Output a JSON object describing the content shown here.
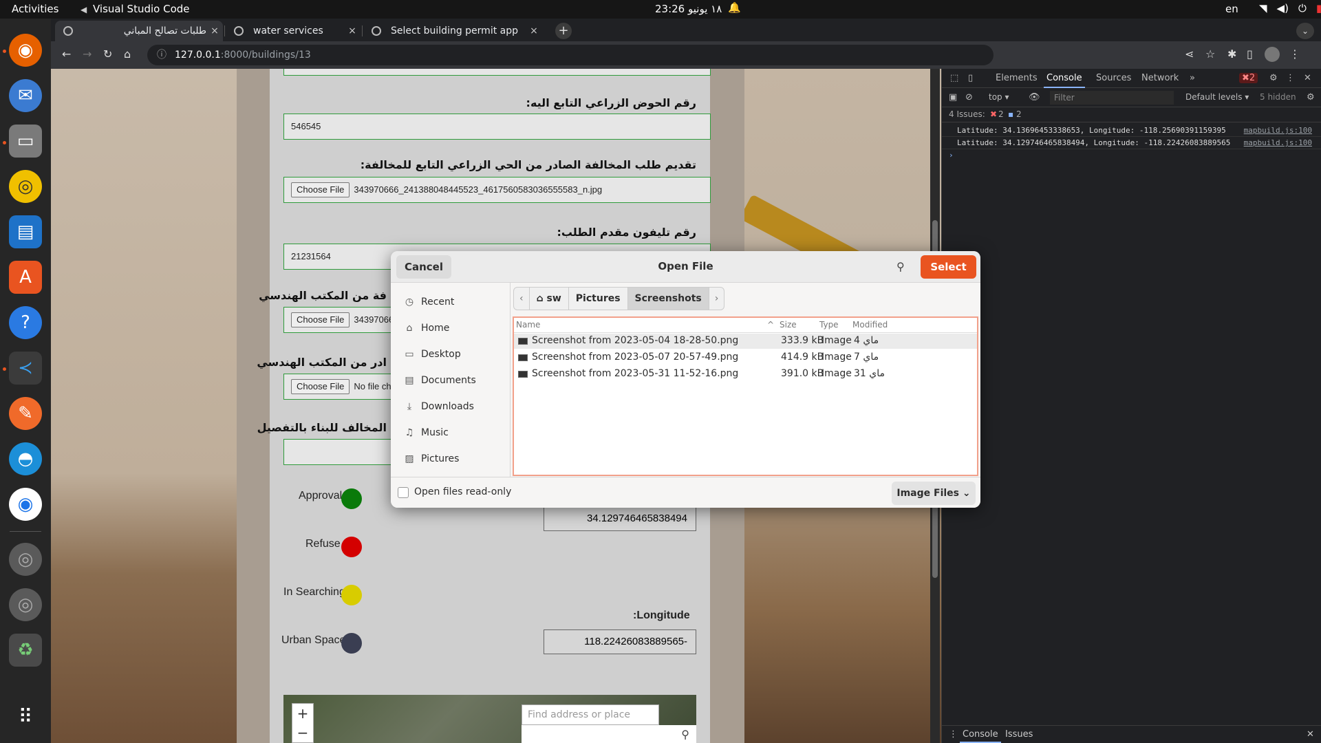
{
  "topbar": {
    "activities": "Activities",
    "app_name": "Visual Studio Code",
    "clock": "23:26 ١٨ يونيو",
    "lang": "en"
  },
  "browser": {
    "tabs": [
      {
        "title": "طلبات تصالح المباني",
        "close": "×"
      },
      {
        "title": "water services",
        "close": "×"
      },
      {
        "title": "Select building permit app",
        "close": "×"
      }
    ],
    "new_tab": "+",
    "url_host": "127.0.0.1",
    "url_path": ":8000/buildings/13"
  },
  "form": {
    "field1_label": "رقم الحوض الزراعي التابع اليه:",
    "field1_value": "546545",
    "field2_label": "تقديم طلب المخالفة الصادر من الحي الزراعي التابع للمخالفة:",
    "field2_button": "Choose File",
    "field2_file": "343970666_241388048445523_4617560583036555583_n.jpg",
    "field3_label": "رقم تليفون مقدم الطلب:",
    "field3_value": "21231564",
    "field4_label": "فة من المكتب الهندسي",
    "field4_button": "Choose File",
    "field4_file": "343970666",
    "field5_label": "ادر من المكتب الهندسي",
    "field5_button": "Choose File",
    "field5_file": "No file ch",
    "field6_label": "المخالف للبناء بالتفصيل",
    "legend": [
      {
        "label": "Approval",
        "color": "#0a7a0a"
      },
      {
        "label": "Refuse",
        "color": "#d40000"
      },
      {
        "label": "In Searching",
        "color": "#d8cc00"
      },
      {
        "label": "Urban Space",
        "color": "#3a3e52"
      }
    ],
    "latitude_value": "34.129746465838494",
    "longitude_label": ":Longitude",
    "longitude_value": "118.22426083889565-",
    "map_search_placeholder": "Find address or place",
    "map_zoom_in": "+",
    "map_zoom_out": "−"
  },
  "devtools": {
    "tabs": [
      "Elements",
      "Console",
      "Sources",
      "Network"
    ],
    "more": "»",
    "error_count": "2",
    "context": "top ▾",
    "filter_placeholder": "Filter",
    "levels": "Default levels ▾",
    "hidden": "5 hidden",
    "issues_label": "4 Issues:",
    "issues_errors": "2",
    "issues_info": "2",
    "console_lines": [
      {
        "text": "Latitude: 34.13696453338653, Longitude: -118.25690391159395",
        "src": "mapbuild.js:100"
      },
      {
        "text": "Latitude: 34.129746465838494, Longitude: -118.22426083889565",
        "src": "mapbuild.js:100"
      }
    ],
    "prompt": "›",
    "drawer_tabs": [
      "Console",
      "Issues"
    ]
  },
  "dialog": {
    "cancel": "Cancel",
    "title": "Open File",
    "select": "Select",
    "places": [
      "Recent",
      "Home",
      "Desktop",
      "Documents",
      "Downloads",
      "Music",
      "Pictures"
    ],
    "path": [
      "sw",
      "Pictures",
      "Screenshots"
    ],
    "columns": {
      "name": "Name",
      "size": "Size",
      "type": "Type",
      "modified": "Modified"
    },
    "files": [
      {
        "name": "Screenshot from 2023-05-04 18-28-50.png",
        "size": "333.9 kB",
        "type": "Image",
        "modified": "4 ماي"
      },
      {
        "name": "Screenshot from 2023-05-07 20-57-49.png",
        "size": "414.9 kB",
        "type": "Image",
        "modified": "7 ماي"
      },
      {
        "name": "Screenshot from 2023-05-31 11-52-16.png",
        "size": "391.0 kB",
        "type": "Image",
        "modified": "31 ماي"
      }
    ],
    "read_only_label": "Open files read-only",
    "filter_label": "Image Files"
  }
}
